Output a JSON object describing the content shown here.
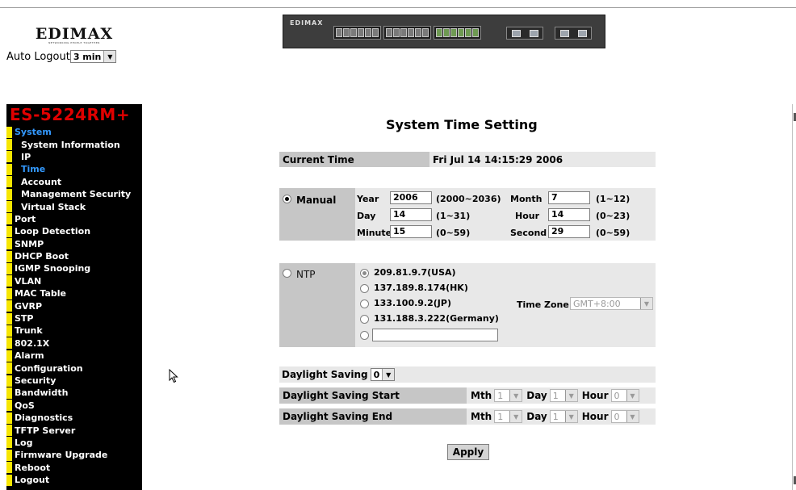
{
  "header": {
    "logo_text": "EDIMAX",
    "logo_tagline": "NETWORKING PEOPLE TOGETHER",
    "auto_logout_label": "Auto Logout",
    "auto_logout_value": "3 min"
  },
  "sidebar": {
    "model": "ES-5224RM+",
    "items": [
      {
        "label": "System",
        "active": true,
        "sub": false
      },
      {
        "label": "System Information",
        "active": false,
        "sub": true
      },
      {
        "label": "IP",
        "active": false,
        "sub": true
      },
      {
        "label": "Time",
        "active": true,
        "sub": true
      },
      {
        "label": "Account",
        "active": false,
        "sub": true
      },
      {
        "label": "Management Security",
        "active": false,
        "sub": true
      },
      {
        "label": "Virtual Stack",
        "active": false,
        "sub": true
      },
      {
        "label": "Port",
        "active": false,
        "sub": false
      },
      {
        "label": "Loop Detection",
        "active": false,
        "sub": false
      },
      {
        "label": "SNMP",
        "active": false,
        "sub": false
      },
      {
        "label": "DHCP Boot",
        "active": false,
        "sub": false
      },
      {
        "label": "IGMP Snooping",
        "active": false,
        "sub": false
      },
      {
        "label": "VLAN",
        "active": false,
        "sub": false
      },
      {
        "label": "MAC Table",
        "active": false,
        "sub": false
      },
      {
        "label": "GVRP",
        "active": false,
        "sub": false
      },
      {
        "label": "STP",
        "active": false,
        "sub": false
      },
      {
        "label": "Trunk",
        "active": false,
        "sub": false
      },
      {
        "label": "802.1X",
        "active": false,
        "sub": false
      },
      {
        "label": "Alarm",
        "active": false,
        "sub": false
      },
      {
        "label": "Configuration",
        "active": false,
        "sub": false
      },
      {
        "label": "Security",
        "active": false,
        "sub": false
      },
      {
        "label": "Bandwidth",
        "active": false,
        "sub": false
      },
      {
        "label": "QoS",
        "active": false,
        "sub": false
      },
      {
        "label": "Diagnostics",
        "active": false,
        "sub": false
      },
      {
        "label": "TFTP Server",
        "active": false,
        "sub": false
      },
      {
        "label": "Log",
        "active": false,
        "sub": false
      },
      {
        "label": "Firmware Upgrade",
        "active": false,
        "sub": false
      },
      {
        "label": "Reboot",
        "active": false,
        "sub": false
      },
      {
        "label": "Logout",
        "active": false,
        "sub": false
      }
    ]
  },
  "main": {
    "title": "System Time Setting",
    "current_time_label": "Current Time",
    "current_time_value": "Fri Jul 14 14:15:29 2006",
    "manual": {
      "label": "Manual",
      "selected": true,
      "year_label": "Year",
      "year_value": "2006",
      "year_range": "(2000~2036)",
      "month_label": "Month",
      "month_value": "7",
      "month_range": "(1~12)",
      "day_label": "Day",
      "day_value": "14",
      "day_range": "(1~31)",
      "hour_label": "Hour",
      "hour_value": "14",
      "hour_range": "(0~23)",
      "minute_label": "Minute",
      "minute_value": "15",
      "minute_range": "(0~59)",
      "second_label": "Second",
      "second_value": "29",
      "second_range": "(0~59)"
    },
    "ntp": {
      "label": "NTP",
      "selected": false,
      "servers": [
        "209.81.9.7(USA)",
        "137.189.8.174(HK)",
        "133.100.9.2(JP)",
        "131.188.3.222(Germany)"
      ],
      "custom_value": "",
      "time_zone_label": "Time Zone",
      "time_zone_value": "GMT+8:00"
    },
    "daylight": {
      "saving_label": "Daylight Saving",
      "saving_value": "0",
      "start_label": "Daylight Saving Start",
      "end_label": "Daylight Saving End",
      "mth_label": "Mth",
      "day_label": "Day",
      "hour_label": "Hour",
      "start_mth": "1",
      "start_day": "1",
      "start_hour": "0",
      "end_mth": "1",
      "end_day": "1",
      "end_hour": "0"
    },
    "apply_label": "Apply"
  },
  "colors": {
    "sidebar_bg": "#000000",
    "model_red": "#e00000",
    "marker_yellow": "#f7e600",
    "active_blue": "#3399ff",
    "header_grey": "#c6c6c6",
    "row_grey": "#e8e8e8"
  }
}
